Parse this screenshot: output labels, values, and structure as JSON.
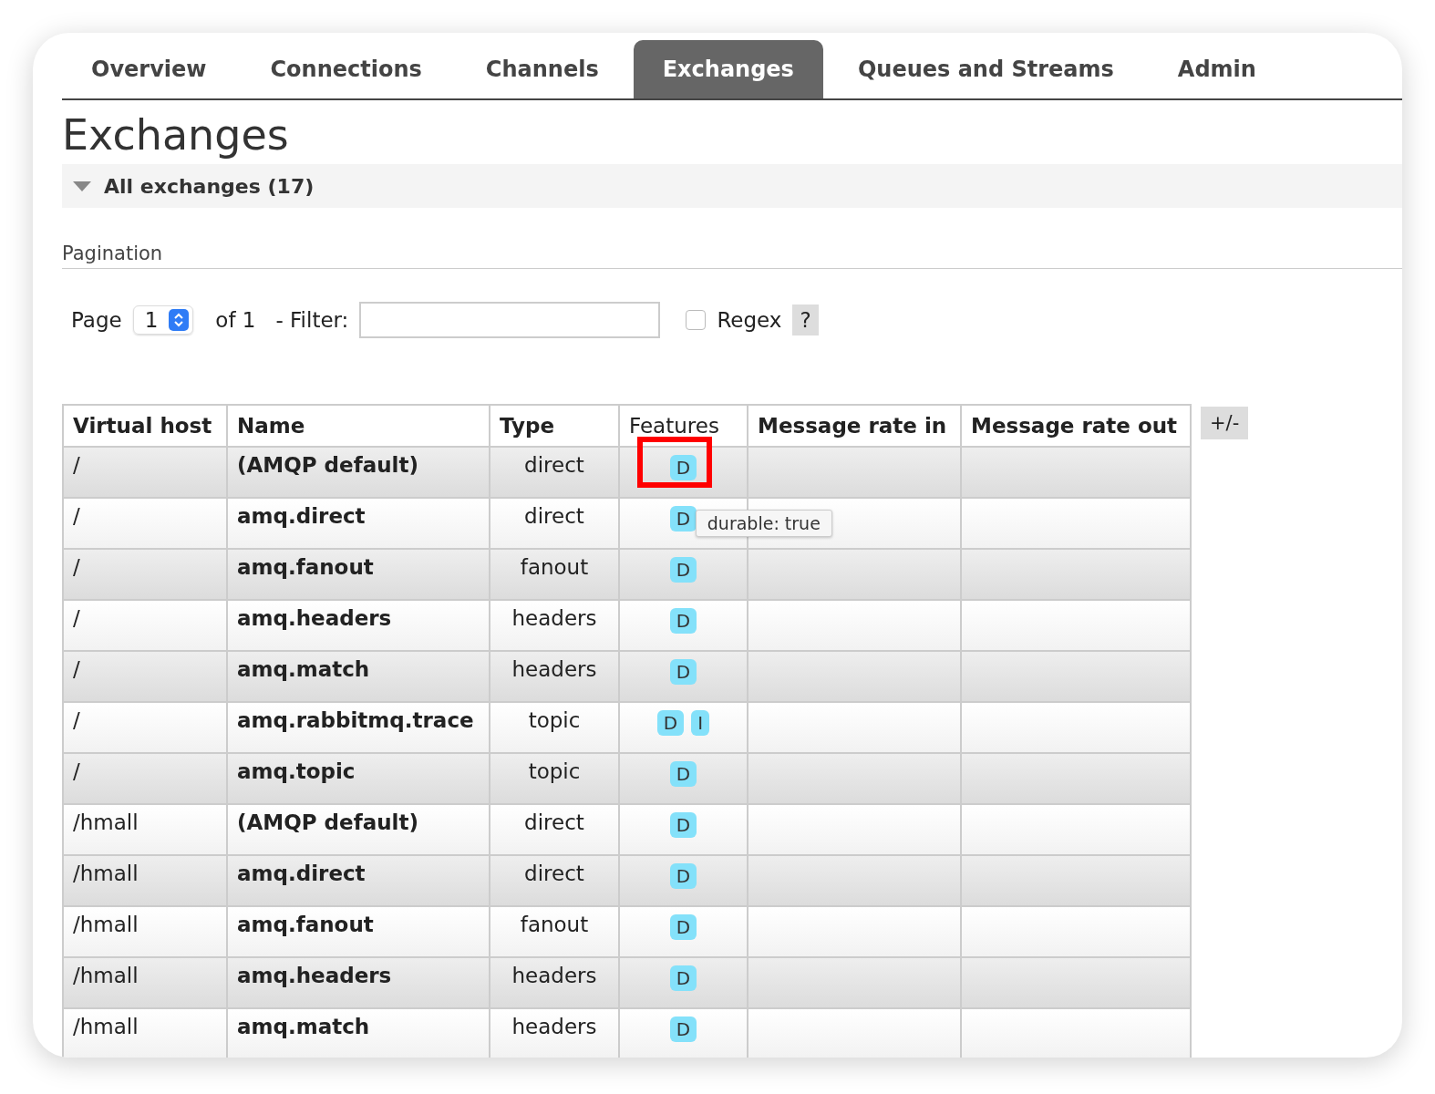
{
  "tabs": [
    {
      "label": "Overview",
      "selected": false
    },
    {
      "label": "Connections",
      "selected": false
    },
    {
      "label": "Channels",
      "selected": false
    },
    {
      "label": "Exchanges",
      "selected": true
    },
    {
      "label": "Queues and Streams",
      "selected": false
    },
    {
      "label": "Admin",
      "selected": false
    }
  ],
  "title": "Exchanges",
  "section": {
    "label": "All exchanges (17)",
    "expanded": true
  },
  "pagination": {
    "heading": "Pagination",
    "page_label": "Page",
    "page": "1",
    "of_label": "of 1",
    "filter_label": "- Filter:",
    "regex": {
      "label": "Regex",
      "checked": false
    },
    "help": "?"
  },
  "table": {
    "columns": [
      "Virtual host",
      "Name",
      "Type",
      "Features",
      "Message rate in",
      "Message rate out"
    ],
    "toggle": "+/-",
    "rows": [
      {
        "vhost": "/",
        "name": "(AMQP default)",
        "type": "direct",
        "features": [
          "D"
        ],
        "highlighted": true
      },
      {
        "vhost": "/",
        "name": "amq.direct",
        "type": "direct",
        "features": [
          "D"
        ],
        "highlighted": false,
        "tooltip": "durable: true"
      },
      {
        "vhost": "/",
        "name": "amq.fanout",
        "type": "fanout",
        "features": [
          "D"
        ],
        "highlighted": false
      },
      {
        "vhost": "/",
        "name": "amq.headers",
        "type": "headers",
        "features": [
          "D"
        ],
        "highlighted": false
      },
      {
        "vhost": "/",
        "name": "amq.match",
        "type": "headers",
        "features": [
          "D"
        ],
        "highlighted": false
      },
      {
        "vhost": "/",
        "name": "amq.rabbitmq.trace",
        "type": "topic",
        "features": [
          "D",
          "I"
        ],
        "highlighted": false
      },
      {
        "vhost": "/",
        "name": "amq.topic",
        "type": "topic",
        "features": [
          "D"
        ],
        "highlighted": false
      },
      {
        "vhost": "/hmall",
        "name": "(AMQP default)",
        "type": "direct",
        "features": [
          "D"
        ],
        "highlighted": false
      },
      {
        "vhost": "/hmall",
        "name": "amq.direct",
        "type": "direct",
        "features": [
          "D"
        ],
        "highlighted": false
      },
      {
        "vhost": "/hmall",
        "name": "amq.fanout",
        "type": "fanout",
        "features": [
          "D"
        ],
        "highlighted": false
      },
      {
        "vhost": "/hmall",
        "name": "amq.headers",
        "type": "headers",
        "features": [
          "D"
        ],
        "highlighted": false
      },
      {
        "vhost": "/hmall",
        "name": "amq.match",
        "type": "headers",
        "features": [
          "D"
        ],
        "highlighted": false
      }
    ]
  }
}
